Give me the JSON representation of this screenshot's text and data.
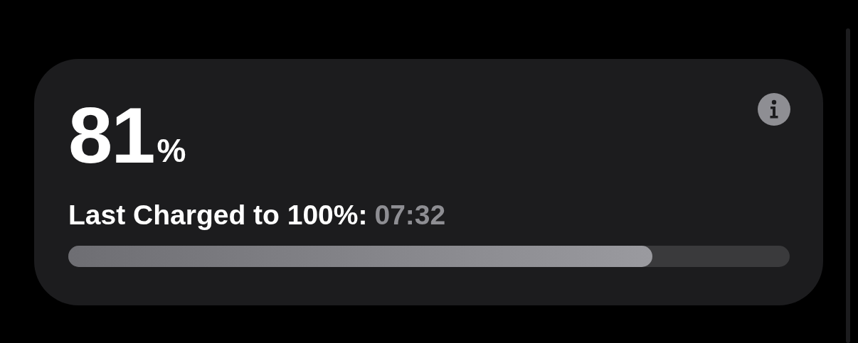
{
  "battery": {
    "percent": "81",
    "unit": "%",
    "last_charged_label": "Last Charged to 100%:",
    "last_charged_time": "07:32",
    "level": 0.81
  }
}
